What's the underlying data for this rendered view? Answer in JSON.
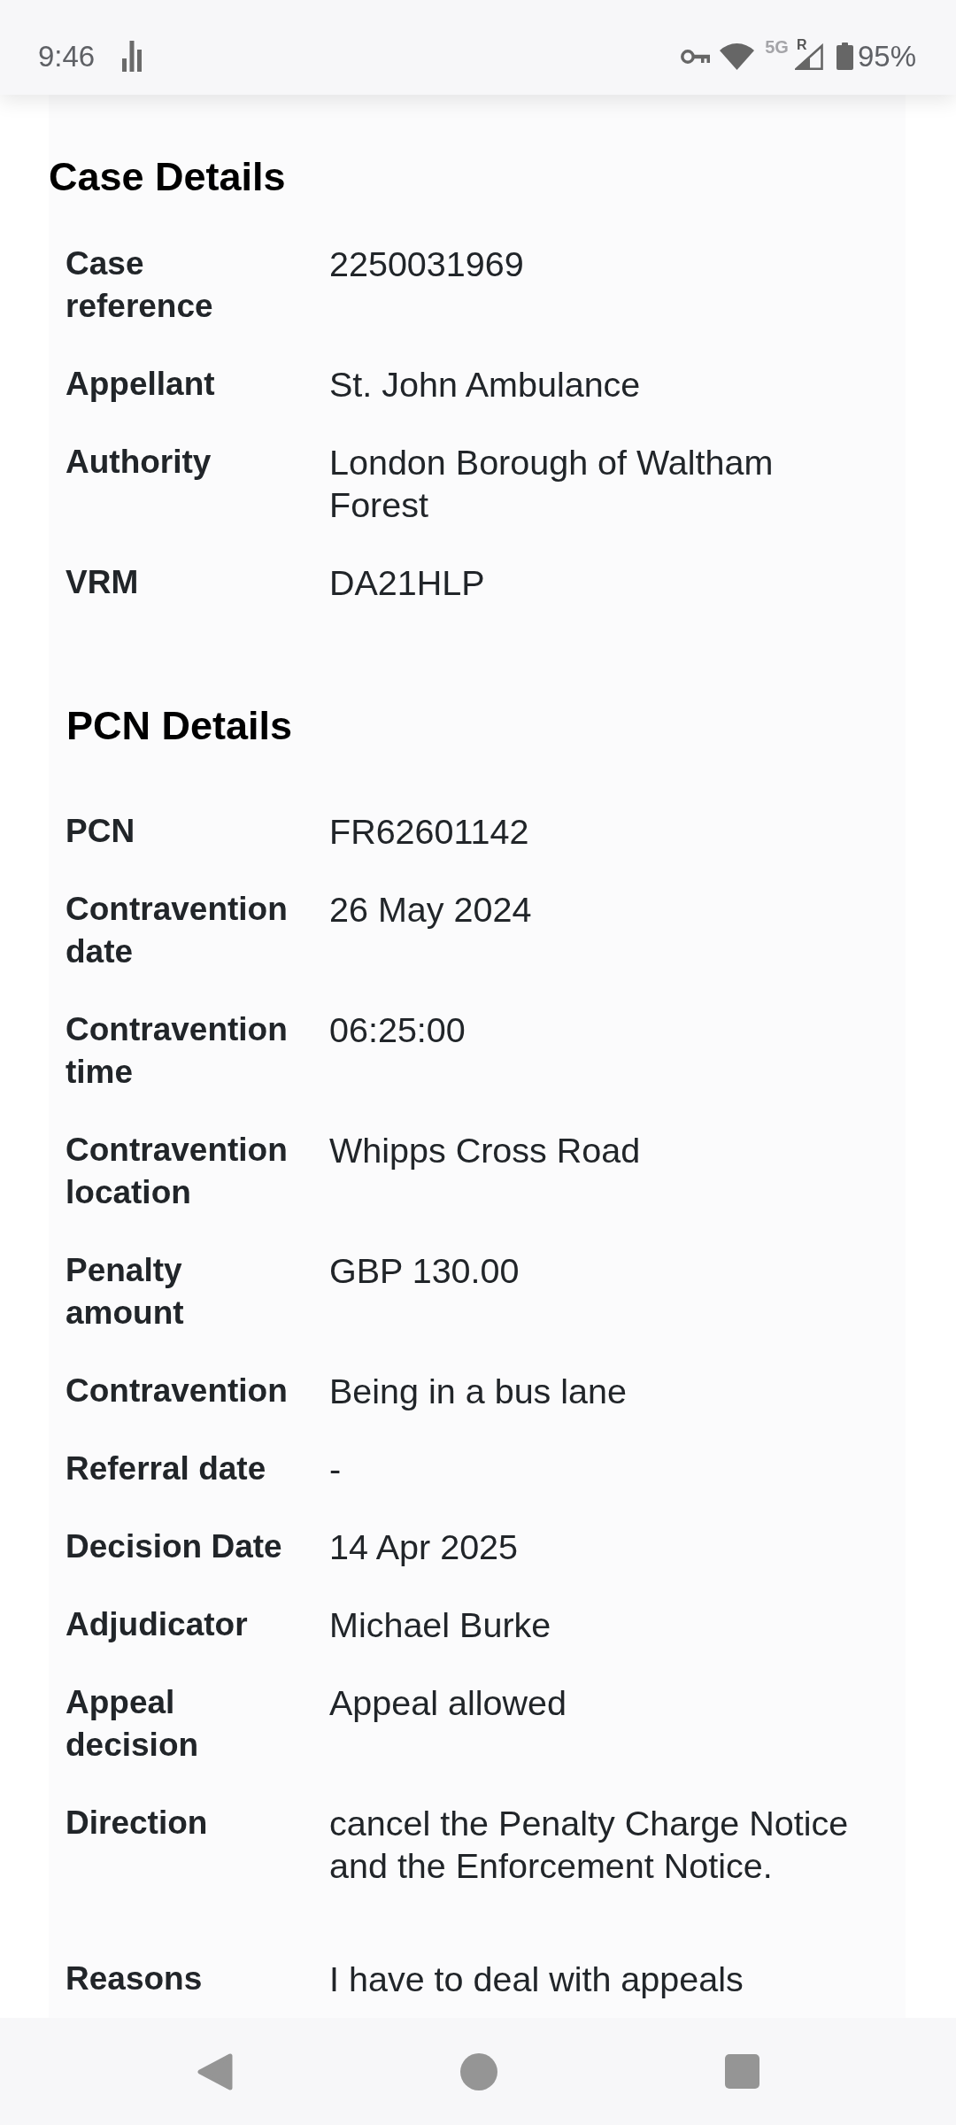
{
  "status_bar": {
    "time": "9:46",
    "network": "5G",
    "roaming": "R",
    "battery": "95%"
  },
  "title": "Case Details",
  "rows": [
    {
      "kind": "field",
      "label": "Case reference",
      "value": "2250031969"
    },
    {
      "kind": "field",
      "label": "Appellant",
      "value": "St. John Ambulance"
    },
    {
      "kind": "field",
      "label": "Authority",
      "value": "London Borough of Waltham Forest"
    },
    {
      "kind": "field",
      "label": "VRM",
      "value": "DA21HLP"
    },
    {
      "kind": "heading",
      "title": "PCN Details"
    },
    {
      "kind": "field",
      "label": "PCN",
      "value": "FR62601142"
    },
    {
      "kind": "field",
      "label": "Contravention date",
      "value": "26 May 2024"
    },
    {
      "kind": "field",
      "label": "Contravention time",
      "value": "06:25:00"
    },
    {
      "kind": "field",
      "label": "Contravention location",
      "value": "Whipps Cross Road"
    },
    {
      "kind": "field",
      "label": "Penalty amount",
      "value": "GBP 130.00"
    },
    {
      "kind": "field",
      "label": "Contravention",
      "value": "Being in a bus lane"
    },
    {
      "kind": "field",
      "label": "Referral date",
      "value": "-"
    },
    {
      "kind": "field",
      "label": "Decision Date",
      "value": "14 Apr 2025"
    },
    {
      "kind": "field",
      "label": "Adjudicator",
      "value": "Michael Burke"
    },
    {
      "kind": "field",
      "label": "Appeal decision",
      "value": "Appeal allowed"
    },
    {
      "kind": "paragraph",
      "label": "Direction",
      "value": "cancel the Penalty Charge Notice and the Enforcement Notice."
    },
    {
      "kind": "paragraph",
      "label": "Reasons",
      "value": "I have to deal with appeals"
    }
  ]
}
